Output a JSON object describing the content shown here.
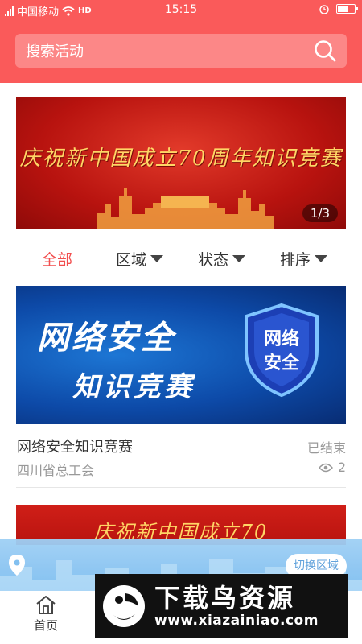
{
  "status_bar": {
    "carrier": "中国移动",
    "network_badge": "HD",
    "time": "15:15",
    "icons": [
      "signal-icon",
      "wifi-icon",
      "alarm-icon",
      "battery-icon"
    ]
  },
  "search": {
    "placeholder": "搜索活动"
  },
  "banner": {
    "title": "庆祝新中国成立70周年知识竞赛",
    "counter": "1/3"
  },
  "filters": {
    "all": "全部",
    "region": "区域",
    "status": "状态",
    "sort": "排序"
  },
  "cards": [
    {
      "image_text_line1": "网络安全",
      "image_text_line2": "知识竞赛",
      "badge_line1": "网络",
      "badge_line2": "安全",
      "title": "网络安全知识竞赛",
      "status": "已结束",
      "organizer": "四川省总工会",
      "views": "2"
    },
    {
      "image_text": "庆祝新中国成立70"
    }
  ],
  "location": {
    "switch_label": "切换区域"
  },
  "tab_bar": {
    "home_label": "首页"
  },
  "watermark": {
    "title": "下载鸟资源",
    "url": "www.xiazainiao.com"
  },
  "colors": {
    "header": "#fa5a5a",
    "search_box": "#fc8787",
    "active_filter": "#f24e4e",
    "muted_text": "#999999"
  }
}
